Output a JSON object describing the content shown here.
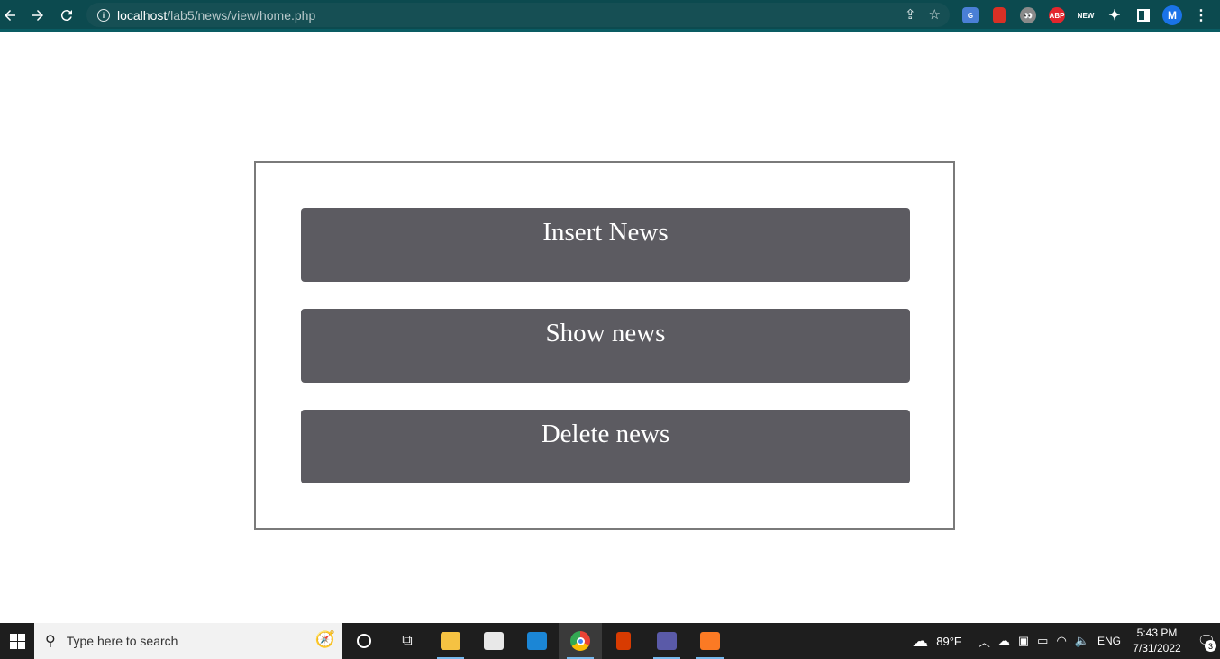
{
  "browser": {
    "url_host": "localhost",
    "url_path": "/lab5/news/view/home.php",
    "profile_initial": "M",
    "extensions": [
      {
        "name": "google-translate",
        "label": "",
        "color": "#4a7fd6"
      },
      {
        "name": "red-book",
        "label": "",
        "color": "#d93025"
      },
      {
        "name": "eyes",
        "label": "",
        "color": "#8a8a8a"
      },
      {
        "name": "adblock-plus",
        "label": "ABP",
        "color": "#e3262d"
      },
      {
        "name": "new-ext",
        "label": "NEW",
        "color": "#0c4a4f"
      }
    ]
  },
  "main": {
    "buttons": [
      {
        "label": "Insert News"
      },
      {
        "label": "Show news"
      },
      {
        "label": "Delete news"
      }
    ]
  },
  "taskbar": {
    "search_placeholder": "Type here to search",
    "weather": "89°F",
    "language": "ENG",
    "time": "5:43 PM",
    "date": "7/31/2022",
    "notification_count": "3"
  }
}
